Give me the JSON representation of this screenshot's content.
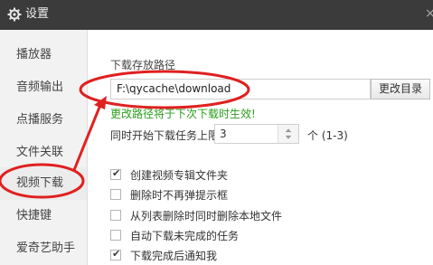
{
  "window": {
    "title": "设置",
    "close_glyph": "×"
  },
  "sidebar": {
    "items": [
      {
        "label": "播放器"
      },
      {
        "label": "音频输出"
      },
      {
        "label": "点播服务"
      },
      {
        "label": "文件关联"
      },
      {
        "label": "视频下载"
      },
      {
        "label": "快捷键"
      },
      {
        "label": "爱奇艺助手"
      }
    ],
    "active_index": 4
  },
  "download": {
    "path_label": "下载存放路径",
    "path_value": "F:\\qycache\\download",
    "change_dir_label": "更改目录",
    "path_hint": "更改路径将于下次下载时生效!",
    "concurrent_label": "同时开始下载任务上限",
    "concurrent_value": "3",
    "concurrent_unit_range": "个 (1-3)"
  },
  "options": [
    {
      "label": "创建视频专辑文件夹",
      "checked": true
    },
    {
      "label": "删除时不再弹提示框",
      "checked": false
    },
    {
      "label": "从列表删除时同时删除本地文件",
      "checked": false
    },
    {
      "label": "自动下载未完成的任务",
      "checked": false
    },
    {
      "label": "下载完成后通知我",
      "checked": true
    }
  ],
  "annotation_color": "#e02020",
  "hint_color": "#2a9d1c"
}
